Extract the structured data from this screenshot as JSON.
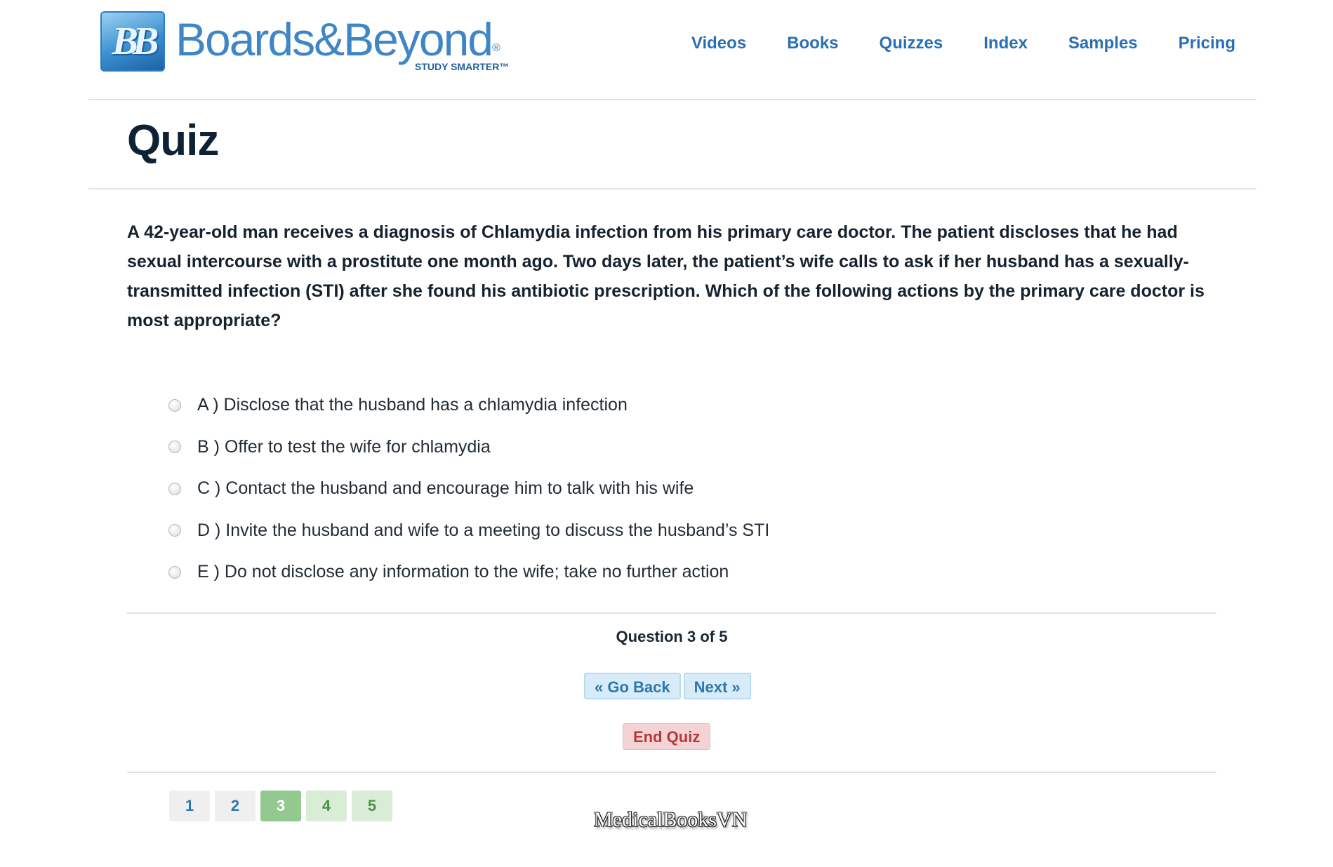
{
  "header": {
    "logo": {
      "badge": "BB",
      "wordmark": "Boards&Beyond",
      "registered": "®",
      "tagline": "STUDY SMARTER™"
    },
    "nav": [
      {
        "label": "Videos"
      },
      {
        "label": "Books"
      },
      {
        "label": "Quizzes"
      },
      {
        "label": "Index"
      },
      {
        "label": "Samples"
      },
      {
        "label": "Pricing"
      }
    ]
  },
  "page": {
    "title": "Quiz"
  },
  "quiz": {
    "question": "A 42-year-old man receives a diagnosis of Chlamydia infection from his primary care doctor. The patient discloses that he had sexual intercourse with a prostitute one month ago. Two days later, the patient’s wife calls to ask if her husband has a sexually-transmitted infection (STI) after she found his antibiotic prescription. Which of the following actions by the primary care doctor is most appropriate?",
    "options": [
      {
        "label": "A ) Disclose that the husband has a chlamydia infection"
      },
      {
        "label": "B ) Offer to test the wife for chlamydia"
      },
      {
        "label": "C ) Contact the husband and encourage him to talk with his wife"
      },
      {
        "label": "D ) Invite the husband and wife to a meeting to discuss the husband’s STI"
      },
      {
        "label": "E ) Do not disclose any information to the wife; take no further action"
      }
    ],
    "counter": "Question 3 of 5",
    "go_back_label": "« Go Back",
    "next_label": "Next »",
    "end_label": "End Quiz",
    "pages": [
      {
        "label": "1",
        "state": "answered"
      },
      {
        "label": "2",
        "state": "answered"
      },
      {
        "label": "3",
        "state": "current"
      },
      {
        "label": "4",
        "state": "unanswered"
      },
      {
        "label": "5",
        "state": "unanswered"
      }
    ]
  },
  "watermark": "MedicalBooksVN",
  "colors": {
    "nav_link": "#2a6fb5",
    "title": "#0e2233",
    "nav_button_bg": "#d7ecf8",
    "end_button_bg": "#f3d3d3",
    "end_button_text": "#b23a3a",
    "page_current": "#93c98f",
    "page_unanswered": "#d9ecd6"
  }
}
